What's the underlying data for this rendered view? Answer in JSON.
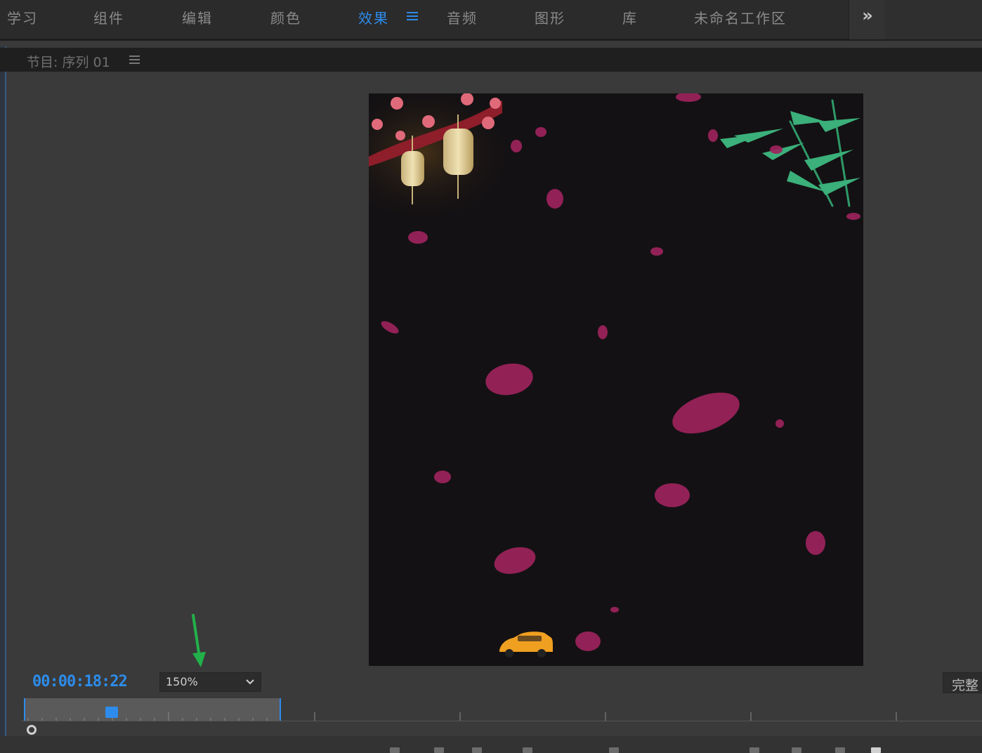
{
  "workspaces": {
    "tabs": [
      {
        "label": "学习",
        "active": false
      },
      {
        "label": "组件",
        "active": false
      },
      {
        "label": "编辑",
        "active": false
      },
      {
        "label": "颜色",
        "active": false
      },
      {
        "label": "效果",
        "active": true
      },
      {
        "label": "音频",
        "active": false
      },
      {
        "label": "图形",
        "active": false
      },
      {
        "label": "库",
        "active": false
      },
      {
        "label": "未命名工作区",
        "active": false
      }
    ],
    "overflow_label": "»"
  },
  "panel": {
    "title": "节目: 序列 01"
  },
  "controls": {
    "timecode": "00:00:18:22",
    "zoom": "150%",
    "quality": "完整"
  },
  "colors": {
    "accent": "#2d8ceb",
    "video_background": "#141114",
    "petal": "#a0235e",
    "annotation_arrow": "#22b04a"
  },
  "icons": {
    "workspace_menu": "hamburger-icon",
    "panel_menu": "hamburger-icon",
    "zoom_dropdown": "chevron-down-icon",
    "overflow": "double-chevron-right-icon"
  }
}
